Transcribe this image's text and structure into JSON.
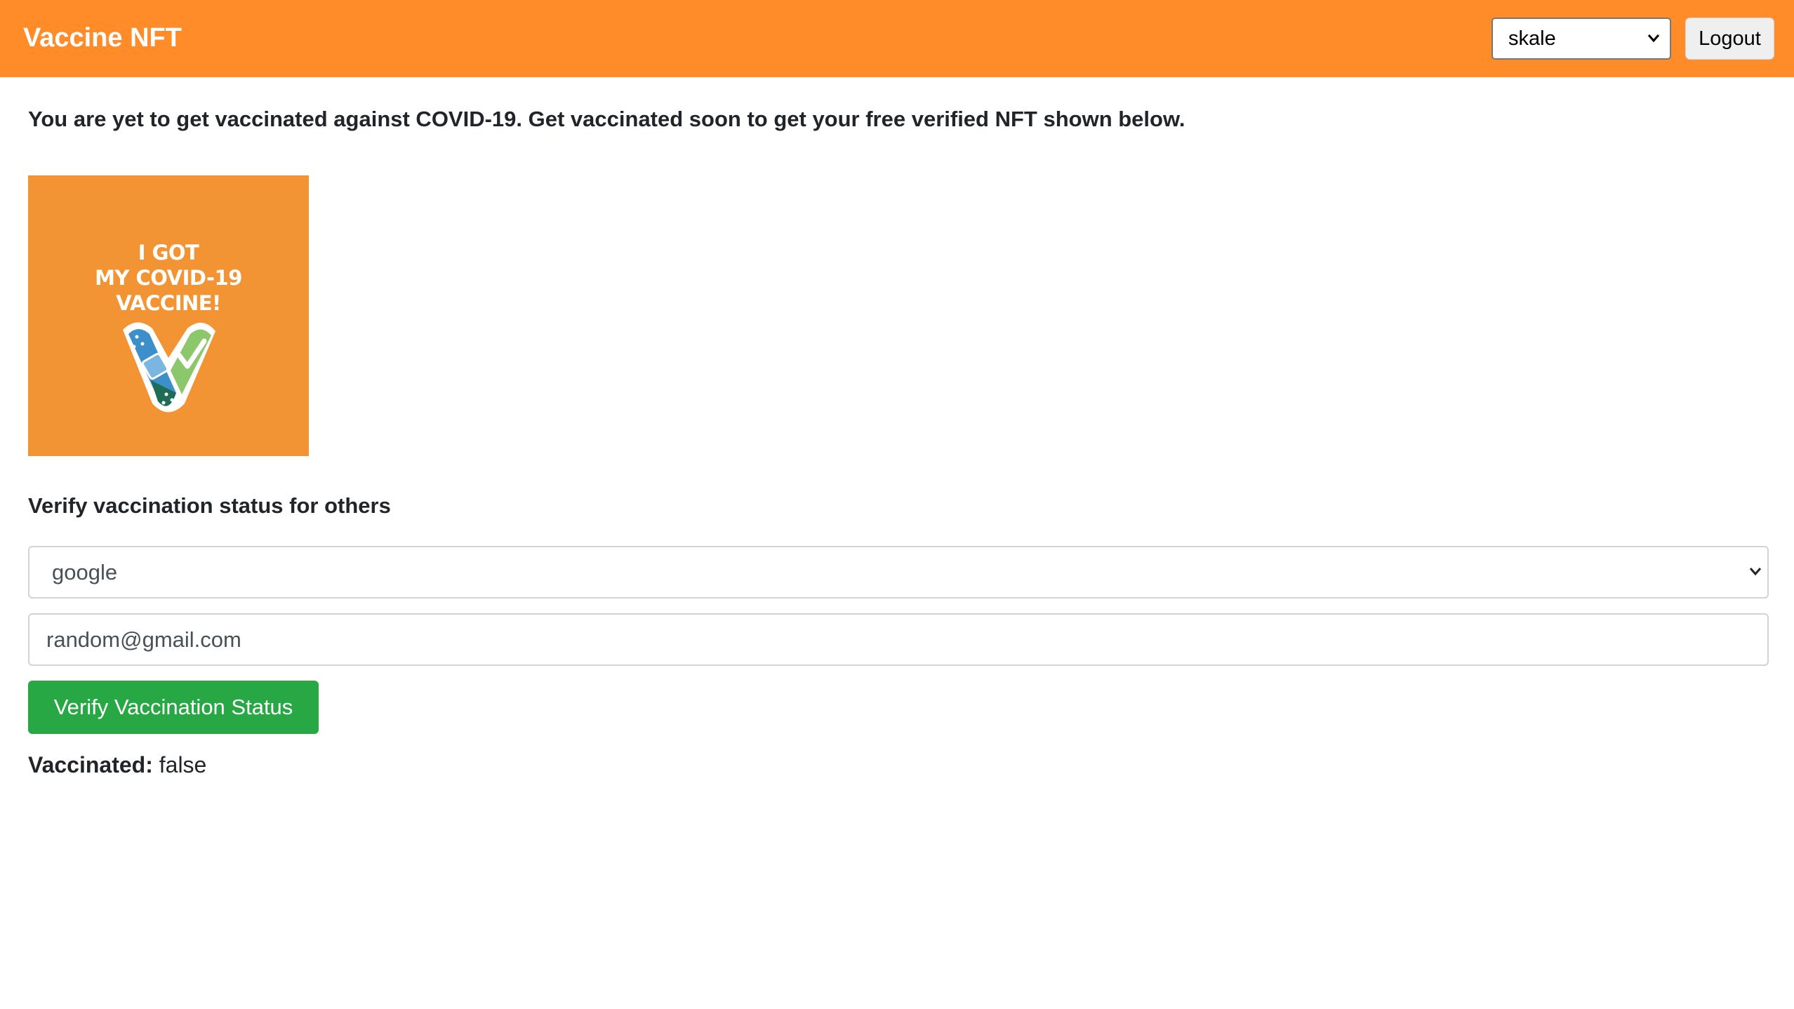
{
  "navbar": {
    "brand": "Vaccine NFT",
    "network_select": {
      "value": "skale",
      "icon": "chevron-down-icon"
    },
    "logout_label": "Logout"
  },
  "main": {
    "status_message": "You are yet to get vaccinated against COVID-19. Get vaccinated soon to get your free verified NFT shown below.",
    "nft": {
      "line1": "I GOT",
      "line2": "MY COVID-19",
      "line3": "VACCINE!",
      "background": "#f39434"
    },
    "verify_section": {
      "heading": "Verify vaccination status for others",
      "provider_select": {
        "value": "google",
        "icon": "chevron-down-icon"
      },
      "email_value": "random@gmail.com",
      "verify_button_label": "Verify Vaccination Status",
      "result_label": "Vaccinated:",
      "result_value": "false"
    }
  },
  "colors": {
    "navbar": "#ff8c28",
    "verify_button": "#28a745"
  }
}
